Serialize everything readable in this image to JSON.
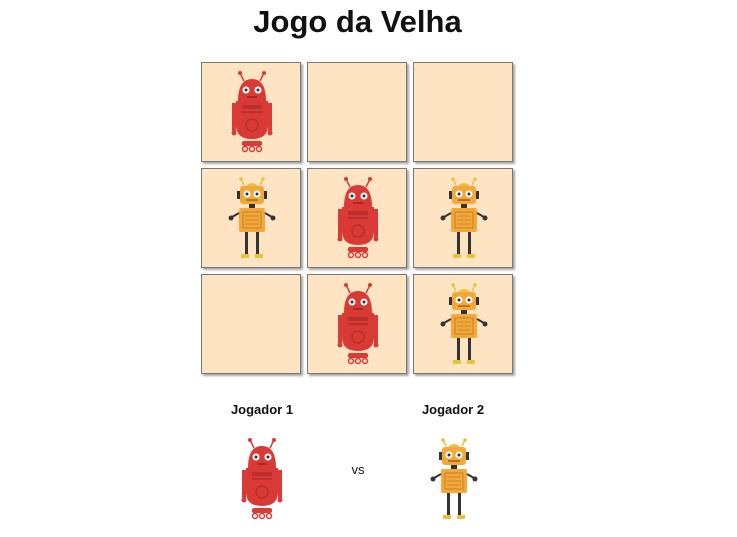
{
  "title": "Jogo da Velha",
  "board": [
    [
      "red",
      "",
      ""
    ],
    [
      "yellow",
      "red",
      "yellow"
    ],
    [
      "",
      "red",
      "yellow"
    ]
  ],
  "players": {
    "player1": {
      "label": "Jogador 1",
      "robot": "red"
    },
    "player2": {
      "label": "Jogador 2",
      "robot": "yellow"
    }
  },
  "vs_label": "vs",
  "colors": {
    "cell_background": "#ffe4c4",
    "red_robot": "#d93a35",
    "yellow_robot": "#f4a83a"
  },
  "icons": {
    "red": "red-robot-icon",
    "yellow": "yellow-robot-icon"
  }
}
